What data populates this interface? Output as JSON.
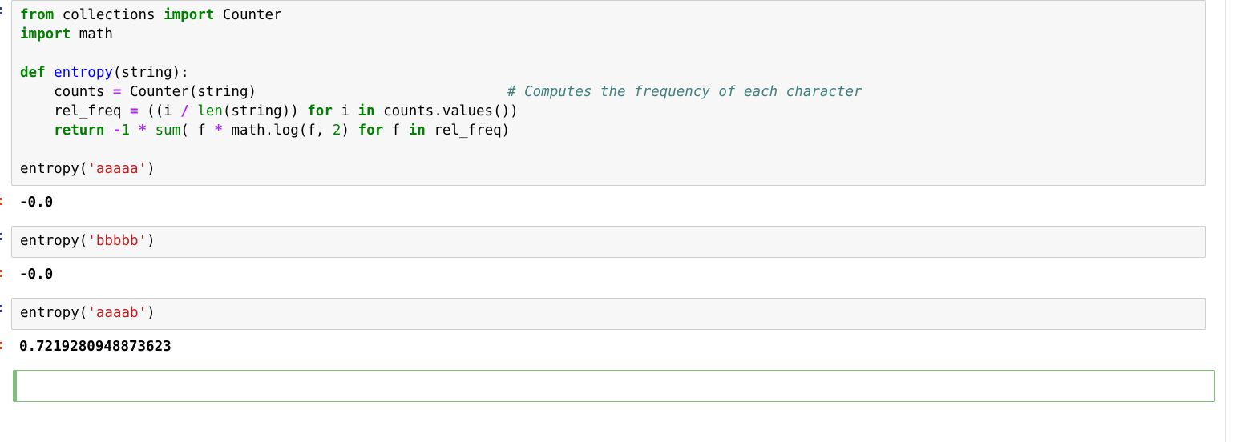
{
  "app": {
    "kind": "jupyter-notebook",
    "selection_border_color": "#7dc17d",
    "in_prompt_color": "#303f9f",
    "out_prompt_color": "#d84315",
    "input_cell_background": "#f7f7f7",
    "input_cell_border": "#cfcfcf"
  },
  "syntax_colors": {
    "keyword": "#008000",
    "function_def": "#0000ff",
    "builtin": "#008000",
    "operator": "#aa22ff",
    "number": "#008000",
    "string": "#ba2121",
    "comment": "#408080",
    "plain": "#000000"
  },
  "cells": [
    {
      "id": "cell-1",
      "type": "code",
      "in_prompt": "]:",
      "out_prompt": "]:",
      "source_lines": [
        "from collections import Counter",
        "import math",
        "",
        "def entropy(string):",
        "    counts = Counter(string)                           # Computes the frequency of each character",
        "    rel_freq = ((i / len(string)) for i in counts.values())",
        "    return -1 * sum( f * math.log(f, 2) for f in rel_freq)",
        "",
        "entropy('aaaaa')"
      ],
      "tokens": {
        "l1_kw_from": "from",
        "l1_mod": " collections ",
        "l1_kw_import": "import",
        "l1_name": " Counter",
        "l2_kw_import": "import",
        "l2_name": " math",
        "l4_kw_def": "def",
        "l4_fn": " entropy",
        "l4_rest": "(string):",
        "l5_indent": "    counts ",
        "l5_op": "=",
        "l5_rest": " Counter(string)",
        "l5_comment": "# Computes the frequency of each character",
        "l6_indent": "    rel_freq ",
        "l6_op1": "=",
        "l6_a": " ((i ",
        "l6_op2": "/",
        "l6_b": " ",
        "l6_len": "len",
        "l6_c": "(string)) ",
        "l6_for": "for",
        "l6_d": " i ",
        "l6_in": "in",
        "l6_e": " counts.values())",
        "l7_indent": "    ",
        "l7_return": "return",
        "l7_op_minus": " -",
        "l7_num1": "1",
        "l7_op_star1": " *",
        "l7_sum": " sum",
        "l7_a": "( f ",
        "l7_op_star2": "*",
        "l7_b": " math.log(f, ",
        "l7_num2": "2",
        "l7_c": ") ",
        "l7_for": "for",
        "l7_d": " f ",
        "l7_in": "in",
        "l7_e": " rel_freq)",
        "l9_call": "entropy(",
        "l9_str": "'aaaaa'",
        "l9_close": ")"
      },
      "output": "-0.0"
    },
    {
      "id": "cell-2",
      "type": "code",
      "in_prompt": "]:",
      "out_prompt": "]:",
      "source_call": "entropy(",
      "source_string": "'bbbbb'",
      "source_close": ")",
      "output": "-0.0"
    },
    {
      "id": "cell-3",
      "type": "code",
      "in_prompt": "]:",
      "out_prompt": "]:",
      "source_call": "entropy(",
      "source_string": "'aaaab'",
      "source_close": ")",
      "output": "0.7219280948873623"
    }
  ]
}
